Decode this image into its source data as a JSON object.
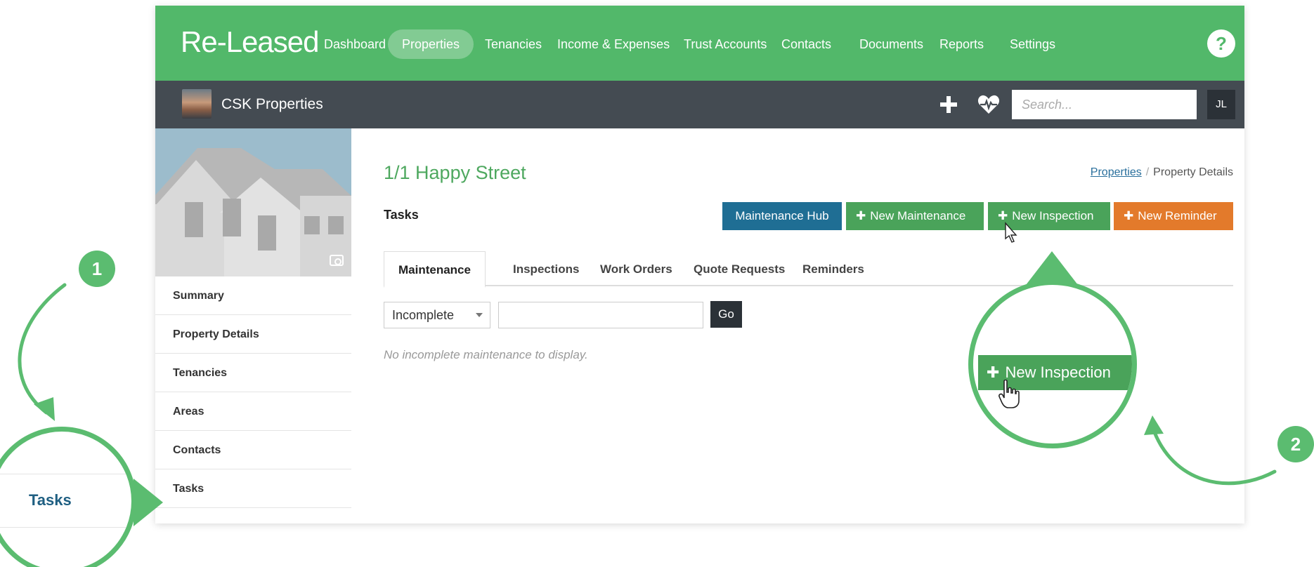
{
  "app": {
    "logo": "Re-Leased"
  },
  "nav": {
    "items": [
      {
        "label": "Dashboard",
        "active": false
      },
      {
        "label": "Properties",
        "active": true
      },
      {
        "label": "Tenancies",
        "active": false
      },
      {
        "label": "Income & Expenses",
        "active": false
      },
      {
        "label": "Trust Accounts",
        "active": false
      },
      {
        "label": "Contacts",
        "active": false
      },
      {
        "label": "Documents",
        "active": false
      },
      {
        "label": "Reports",
        "active": false
      },
      {
        "label": "Settings",
        "active": false
      }
    ],
    "help": "?"
  },
  "subbar": {
    "org_name": "CSK Properties",
    "search_placeholder": "Search...",
    "user_initials": "JL"
  },
  "sidebar": {
    "items": [
      {
        "label": "Summary"
      },
      {
        "label": "Property Details"
      },
      {
        "label": "Tenancies"
      },
      {
        "label": "Areas"
      },
      {
        "label": "Contacts"
      },
      {
        "label": "Tasks"
      }
    ]
  },
  "main": {
    "property_title": "1/1 Happy Street",
    "breadcrumb": {
      "link": "Properties",
      "separator": "/",
      "current": "Property Details"
    },
    "section_label": "Tasks",
    "buttons": {
      "hub": "Maintenance Hub",
      "new_maintenance": "New Maintenance",
      "new_inspection": "New Inspection",
      "new_reminder": "New Reminder"
    },
    "tabs": [
      {
        "label": "Maintenance",
        "active": true
      },
      {
        "label": "Inspections",
        "active": false
      },
      {
        "label": "Work Orders",
        "active": false
      },
      {
        "label": "Quote Requests",
        "active": false
      },
      {
        "label": "Reminders",
        "active": false
      }
    ],
    "filter": {
      "status": "Incomplete",
      "text_value": "",
      "go": "Go"
    },
    "empty_message": "No incomplete maintenance to display."
  },
  "annotations": {
    "step1": "1",
    "step2": "2",
    "zoom_tasks_label": "Tasks",
    "zoom_button_label": "New Inspection"
  },
  "colors": {
    "brand_green": "#52b86a",
    "subbar": "#444b52",
    "hub_blue": "#1f6e94",
    "action_green": "#4aa35a",
    "reminder_orange": "#e37a2b",
    "title_green": "#4ea85f"
  }
}
